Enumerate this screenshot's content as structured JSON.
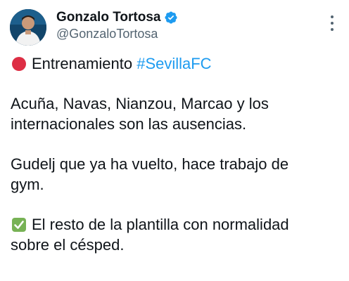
{
  "author": {
    "display_name": "Gonzalo Tortosa",
    "handle": "@GonzaloTortosa",
    "verified": true,
    "verified_color": "#1d9bf0",
    "avatar_icon": "profile-photo"
  },
  "menu_icon": "more-vertical-icon",
  "tweet": {
    "line1_text": "Entrenamiento ",
    "line1_hashtag": "#SevillaFC",
    "line1_emoji": "red-circle-icon",
    "para2_line1": "Acuña, Navas, Nianzou, Marcao y los",
    "para2_line2": "internacionales son las ausencias.",
    "para3_line1": "Gudelj que ya ha vuelto, hace trabajo de",
    "para3_line2": "gym.",
    "para4_emoji": "check-mark-button-icon",
    "para4_line1": "El resto de la plantilla con normalidad",
    "para4_line2": "sobre el césped."
  },
  "colors": {
    "text": "#0f1419",
    "secondary": "#536471",
    "link": "#1d9bf0",
    "red_circle": "#dd2e44",
    "check_green": "#77b255"
  }
}
